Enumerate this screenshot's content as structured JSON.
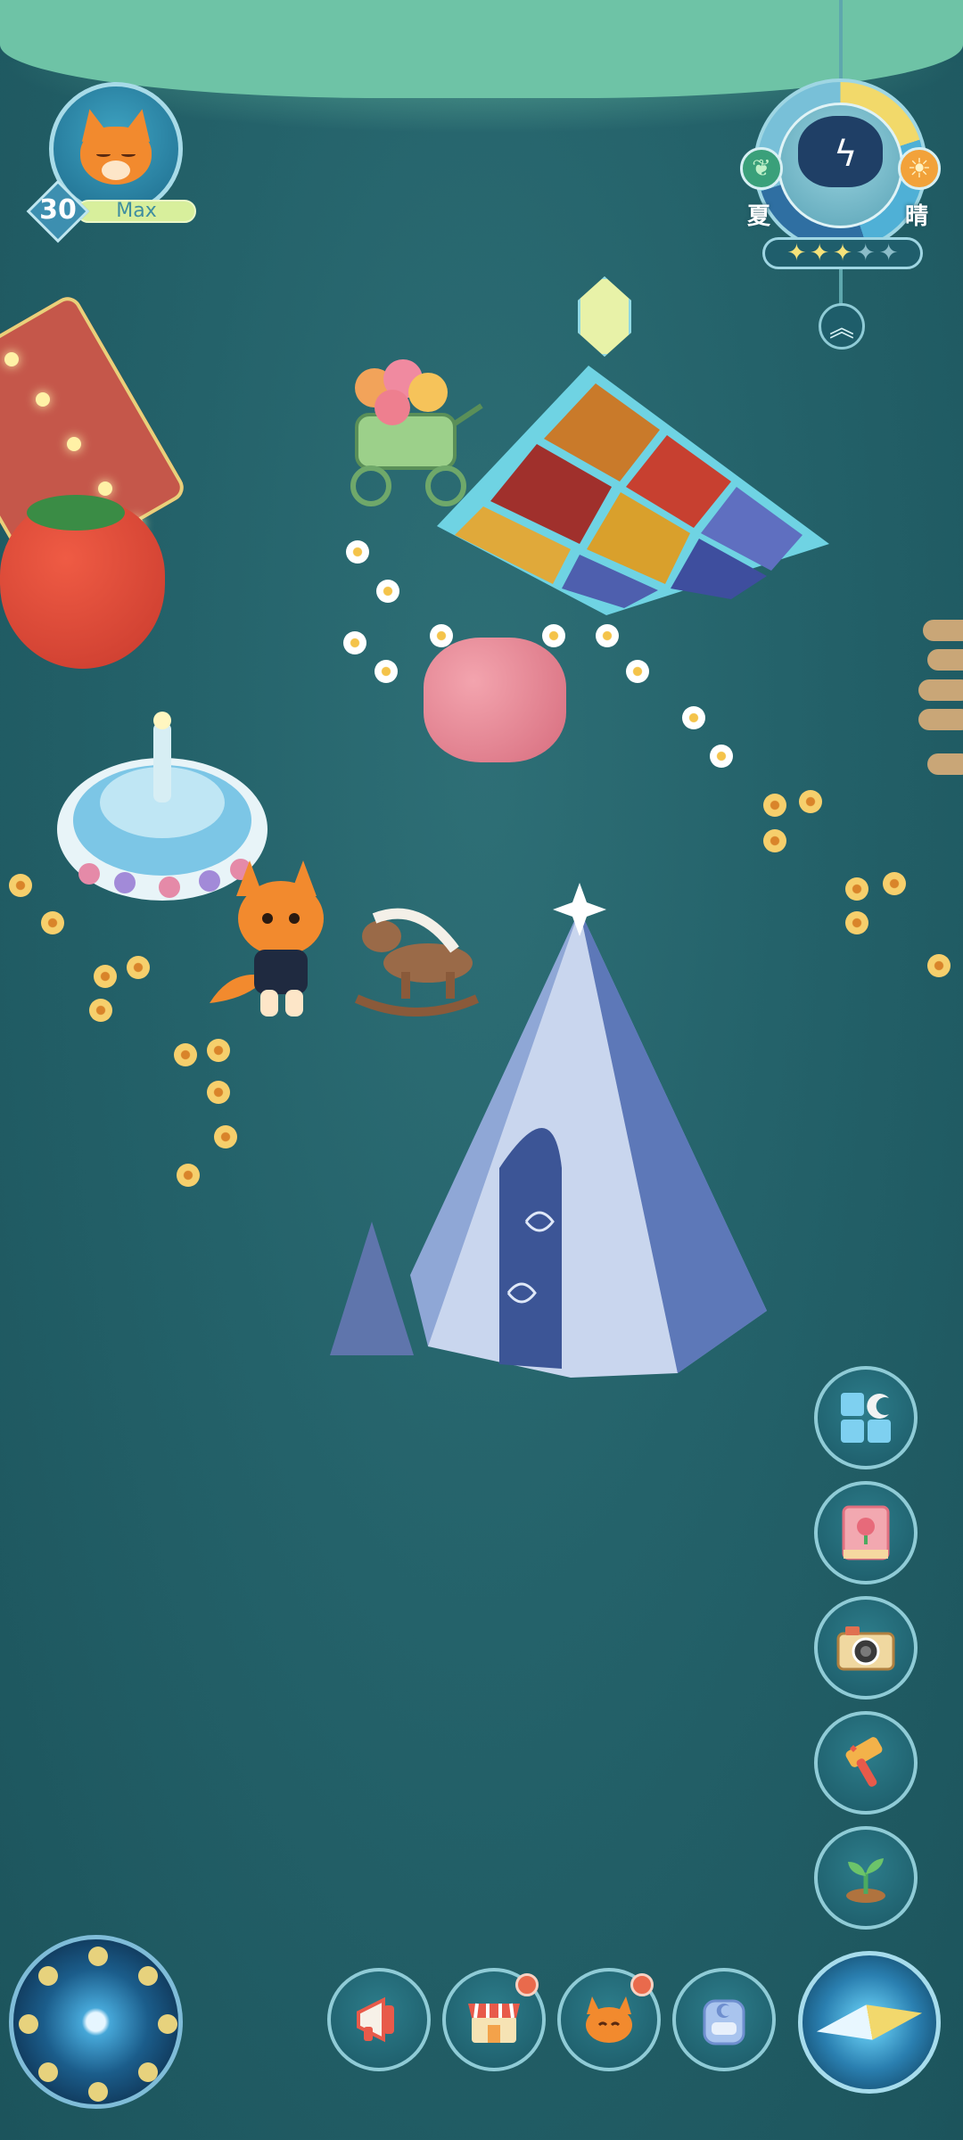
{
  "player": {
    "level": "30",
    "level_label": "Max"
  },
  "weather": {
    "season": "夏",
    "condition": "晴",
    "stars_filled": 3,
    "stars_total": 5
  },
  "side_buttons": [
    {
      "name": "build-mode-button",
      "icon": "grid-moon-icon"
    },
    {
      "name": "flower-guide-button",
      "icon": "book-icon"
    },
    {
      "name": "camera-button",
      "icon": "camera-icon"
    },
    {
      "name": "hammer-button",
      "icon": "hammer-icon"
    },
    {
      "name": "plant-button",
      "icon": "sprout-icon"
    }
  ],
  "bottom_buttons": [
    {
      "name": "announcement-button",
      "icon": "megaphone-icon",
      "badge": false
    },
    {
      "name": "shop-button",
      "icon": "shop-icon",
      "badge": true
    },
    {
      "name": "character-button",
      "icon": "fox-icon",
      "badge": true
    },
    {
      "name": "backpack-button",
      "icon": "backpack-icon",
      "badge": false
    }
  ],
  "colors": {
    "background": "#24626a",
    "button_ring": "#8fcbd6",
    "badge": "#e96a4c",
    "accent_yellow": "#f5e27a"
  }
}
